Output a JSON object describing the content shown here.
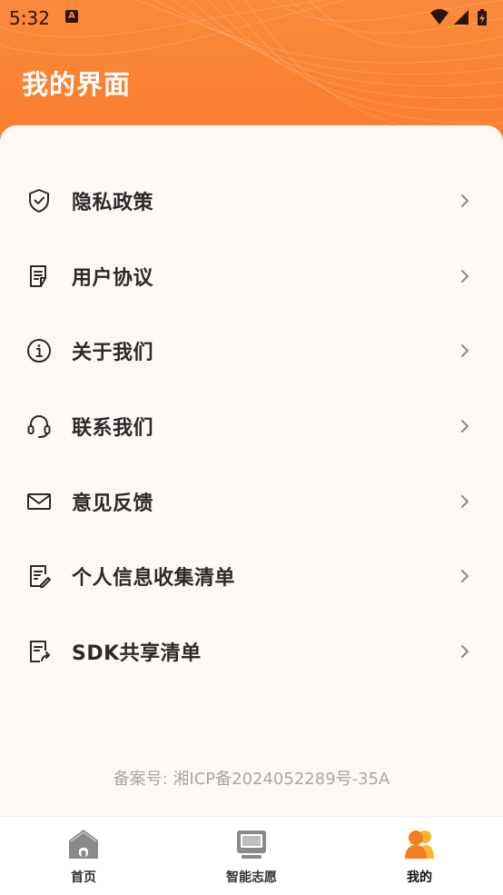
{
  "status_bar": {
    "time": "5:32",
    "notification_icon": "a-letter-icon",
    "right_icons": [
      "wifi-icon",
      "signal-icon",
      "battery-charging-icon"
    ]
  },
  "header": {
    "title": "我的界面"
  },
  "menu": {
    "items": [
      {
        "label": "隐私政策",
        "icon": "shield-check-icon"
      },
      {
        "label": "用户协议",
        "icon": "document-icon"
      },
      {
        "label": "关于我们",
        "icon": "info-icon"
      },
      {
        "label": "联系我们",
        "icon": "headset-icon"
      },
      {
        "label": "意见反馈",
        "icon": "mail-icon"
      },
      {
        "label": "个人信息收集清单",
        "icon": "edit-list-icon"
      },
      {
        "label": "SDK共享清单",
        "icon": "share-list-icon"
      }
    ]
  },
  "footer": {
    "icp": "备案号: 湘ICP备2024052289号-35A"
  },
  "tabbar": {
    "tabs": [
      {
        "label": "首页",
        "icon": "home-icon",
        "active": false
      },
      {
        "label": "智能志愿",
        "icon": "monitor-icon",
        "active": false
      },
      {
        "label": "我的",
        "icon": "users-icon",
        "active": true
      }
    ]
  },
  "colors": {
    "header_orange": "#fa7f30",
    "accent_orange": "#f57c1f",
    "accent_yellow": "#f7b52c",
    "text_dark": "#2a2a2a",
    "icp_gray": "#a8a8a8",
    "inactive_icon_gray": "#8a8a8a"
  }
}
